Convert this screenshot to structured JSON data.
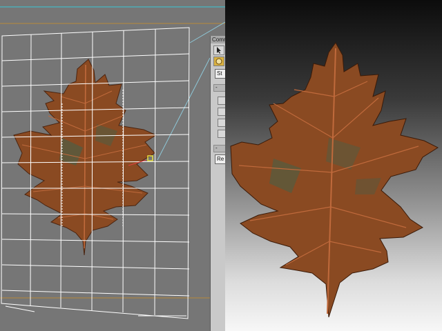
{
  "command_panel": {
    "title": "Comm",
    "field_1": "St",
    "field_2": "Re",
    "rollout_1": "-",
    "rollout_2": "-"
  },
  "icons": {
    "select": "arrow-cursor-icon",
    "material": "sphere-material-icon"
  },
  "colors": {
    "viewport_bg": "#767676",
    "grid_lines": "#ffffff",
    "leaf_main": "#8a4a22",
    "leaf_dark": "#5e2f14",
    "leaf_vein": "#c06a3c",
    "leaf_green": "#4e5e44",
    "panel_bg": "#c9c9c9",
    "guide_cyan": "#38c8d8",
    "guide_orange": "#b88a3a"
  }
}
